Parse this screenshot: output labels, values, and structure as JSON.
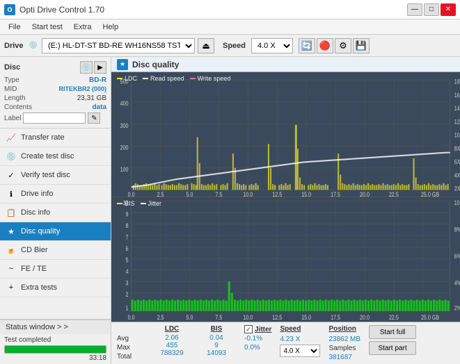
{
  "titlebar": {
    "title": "Opti Drive Control 1.70",
    "icon": "O",
    "minimize_label": "—",
    "maximize_label": "□",
    "close_label": "✕"
  },
  "menubar": {
    "items": [
      "File",
      "Start test",
      "Extra",
      "Help"
    ]
  },
  "drive_toolbar": {
    "drive_label": "Drive",
    "drive_value": "(E:)  HL-DT-ST BD-RE  WH16NS58 TST4",
    "speed_label": "Speed",
    "speed_value": "4.0 X"
  },
  "disc_panel": {
    "title": "Disc",
    "type_label": "Type",
    "type_value": "BD-R",
    "mid_label": "MID",
    "mid_value": "RITEKBR2 (000)",
    "length_label": "Length",
    "length_value": "23,31 GB",
    "contents_label": "Contents",
    "contents_value": "data",
    "label_label": "Label",
    "label_placeholder": ""
  },
  "nav_items": [
    {
      "id": "transfer-rate",
      "label": "Transfer rate",
      "icon": "📈"
    },
    {
      "id": "create-test-disc",
      "label": "Create test disc",
      "icon": "💿"
    },
    {
      "id": "verify-test-disc",
      "label": "Verify test disc",
      "icon": "✓"
    },
    {
      "id": "drive-info",
      "label": "Drive info",
      "icon": "ℹ"
    },
    {
      "id": "disc-info",
      "label": "Disc info",
      "icon": "📋"
    },
    {
      "id": "disc-quality",
      "label": "Disc quality",
      "icon": "★",
      "active": true
    },
    {
      "id": "cd-bier",
      "label": "CD Bier",
      "icon": "🍺"
    },
    {
      "id": "fe-te",
      "label": "FE / TE",
      "icon": "~"
    },
    {
      "id": "extra-tests",
      "label": "Extra tests",
      "icon": "+"
    }
  ],
  "status_window": {
    "label": "Status window > >",
    "status_text": "Test completed",
    "progress_percent": 100,
    "time": "33:18"
  },
  "disc_quality": {
    "title": "Disc quality",
    "top_chart": {
      "legend": [
        {
          "id": "ldc",
          "label": "LDC",
          "color": "#e0e030"
        },
        {
          "id": "read-speed",
          "label": "Read speed",
          "color": "#ffffff"
        },
        {
          "id": "write-speed",
          "label": "Write speed",
          "color": "#ff69b4"
        }
      ],
      "y_labels_right": [
        "18X",
        "16X",
        "14X",
        "12X",
        "10X",
        "8X",
        "6X",
        "4X",
        "2X"
      ],
      "y_labels_left": [
        "500",
        "400",
        "300",
        "200",
        "100"
      ],
      "x_labels": [
        "0.0",
        "2.5",
        "5.0",
        "7.5",
        "10.0",
        "12.5",
        "15.0",
        "17.5",
        "20.0",
        "22.5",
        "25.0 GB"
      ]
    },
    "bottom_chart": {
      "legend": [
        {
          "id": "bis",
          "label": "BIS",
          "color": "#e0e030"
        },
        {
          "id": "jitter",
          "label": "Jitter",
          "color": "#ffffff"
        }
      ],
      "y_labels_left": [
        "10",
        "9",
        "8",
        "7",
        "6",
        "5",
        "4",
        "3",
        "2",
        "1"
      ],
      "y_labels_right": [
        "10%",
        "8%",
        "6%",
        "4%",
        "2%"
      ],
      "x_labels": [
        "0.0",
        "2.5",
        "5.0",
        "7.5",
        "10.0",
        "12.5",
        "15.0",
        "17.5",
        "20.0",
        "22.5",
        "25.0 GB"
      ]
    },
    "stats": {
      "ldc_header": "LDC",
      "bis_header": "BIS",
      "jitter_header": "Jitter",
      "speed_header": "Speed",
      "avg_label": "Avg",
      "max_label": "Max",
      "total_label": "Total",
      "ldc_avg": "2.06",
      "ldc_max": "455",
      "ldc_total": "788329",
      "bis_avg": "0.04",
      "bis_max": "9",
      "bis_total": "14093",
      "jitter_avg": "-0.1%",
      "jitter_max": "0.0%",
      "speed_val": "4.23 X",
      "speed_select": "4.0 X",
      "position_label": "Position",
      "position_val": "23862 MB",
      "samples_label": "Samples",
      "samples_val": "381687",
      "start_full_label": "Start full",
      "start_part_label": "Start part"
    }
  }
}
